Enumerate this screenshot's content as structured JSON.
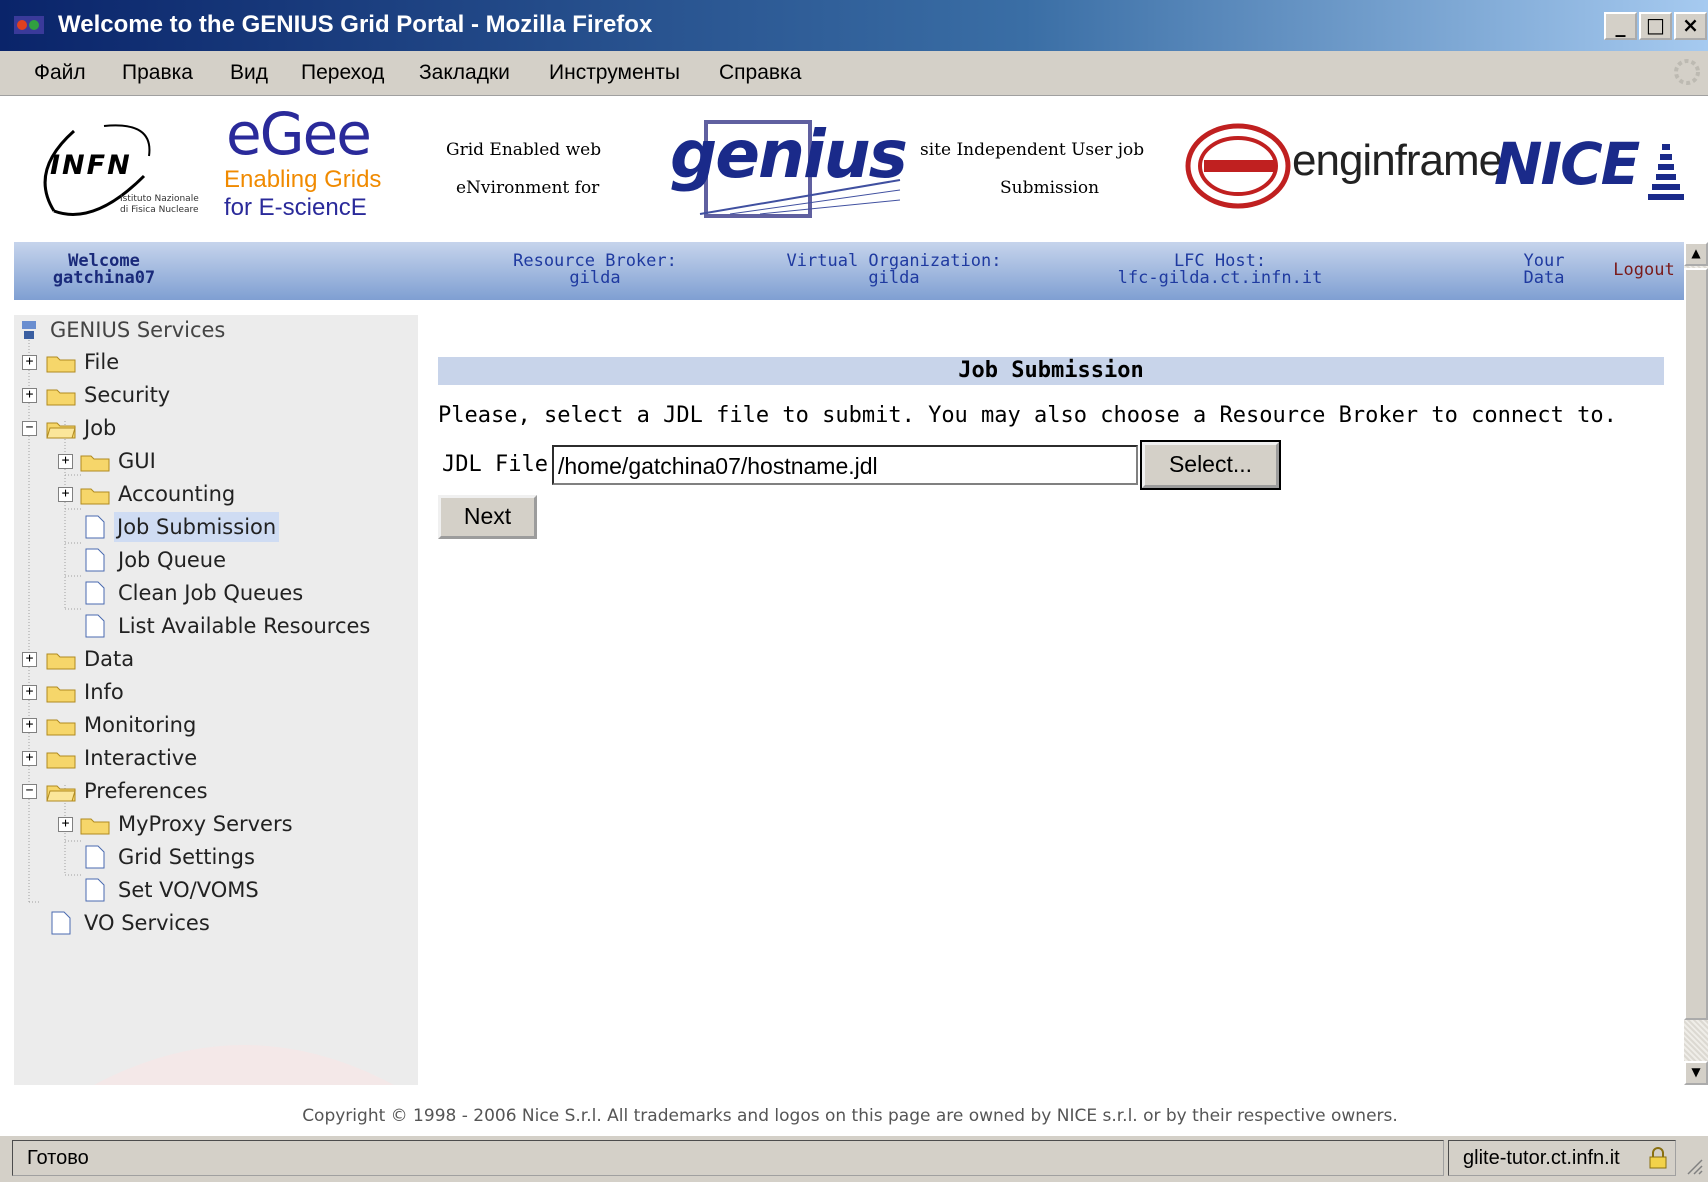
{
  "window": {
    "title": "Welcome to the GENIUS Grid Portal - Mozilla Firefox",
    "buttons": [
      "_",
      "□",
      "×"
    ]
  },
  "menu": [
    "Файл",
    "Правка",
    "Вид",
    "Переход",
    "Закладки",
    "Инструменты",
    "Справка"
  ],
  "banner": {
    "infn": "INFN",
    "infn_sub1": "Istituto Nazionale",
    "infn_sub2": "di Fisica Nucleare",
    "egee": "eGee",
    "egee_line1": "Enabling Grids",
    "egee_line2": "for E-sciencE",
    "genius_left_1": "Grid Enabled web",
    "genius_left_2": "eNvironment for",
    "genius": "genius",
    "genius_right_1": "site Independent User job",
    "genius_right_2": "Submission",
    "enginframe": "enginframe",
    "nice": "NICE"
  },
  "infobar": {
    "welcome_label": "Welcome",
    "welcome_user": "gatchina07",
    "rb_label": "Resource Broker:",
    "rb_value": "gilda",
    "vo_label": "Virtual Organization:",
    "vo_value": "gilda",
    "lfc_label": "LFC Host:",
    "lfc_value": "lfc-gilda.ct.infn.it",
    "your_data_1": "Your",
    "your_data_2": "Data",
    "logout": "Logout"
  },
  "sidebar": {
    "root": "GENIUS Services",
    "items": [
      {
        "label": "File"
      },
      {
        "label": "Security"
      },
      {
        "label": "Job"
      },
      {
        "label": "GUI"
      },
      {
        "label": "Accounting"
      },
      {
        "label": "Job Submission"
      },
      {
        "label": "Job Queue"
      },
      {
        "label": "Clean Job Queues"
      },
      {
        "label": "List Available Resources"
      },
      {
        "label": "Data"
      },
      {
        "label": "Info"
      },
      {
        "label": "Monitoring"
      },
      {
        "label": "Interactive"
      },
      {
        "label": "Preferences"
      },
      {
        "label": "MyProxy Servers"
      },
      {
        "label": "Grid Settings"
      },
      {
        "label": "Set VO/VOMS"
      },
      {
        "label": "VO Services"
      }
    ]
  },
  "main": {
    "header": "Job Submission",
    "instruction": "Please, select a JDL file to submit. You may also choose a Resource Broker to connect to.",
    "jdl_label": "JDL File",
    "jdl_value": "/home/gatchina07/hostname.jdl",
    "select_button": "Select...",
    "next_button": "Next"
  },
  "footer": {
    "copyright": "Copyright © 1998 - 2006 Nice S.r.l. All trademarks and logos on this page are owned by NICE s.r.l. or by their respective owners."
  },
  "statusbar": {
    "status": "Готово",
    "host": "glite-tutor.ct.infn.it"
  }
}
